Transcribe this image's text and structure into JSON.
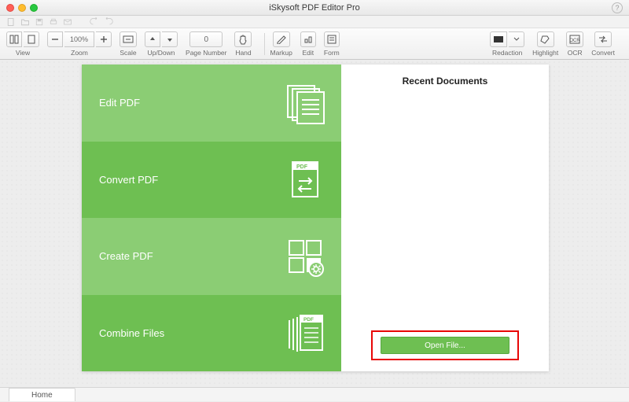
{
  "app": {
    "title": "iSkysoft PDF Editor Pro"
  },
  "toolbar": {
    "view": "View",
    "zoom_label": "Zoom",
    "zoom_value": "100%",
    "scale": "Scale",
    "updown": "Up/Down",
    "page_number_label": "Page Number",
    "page_number_value": "0",
    "hand": "Hand",
    "markup": "Markup",
    "edit": "Edit",
    "form": "Form",
    "redaction": "Redaction",
    "highlight": "Highlight",
    "ocr": "OCR",
    "convert": "Convert"
  },
  "welcome": {
    "tiles": [
      {
        "label": "Edit PDF"
      },
      {
        "label": "Convert PDF"
      },
      {
        "label": "Create PDF"
      },
      {
        "label": "Combine Files"
      }
    ],
    "recent_title": "Recent Documents",
    "open_file": "Open File...",
    "pdf_badge": "PDF"
  },
  "tabs": {
    "home": "Home"
  },
  "colors": {
    "tile_light": "#8bcd74",
    "tile_dark": "#6ebf52",
    "highlight_box": "#e80606"
  }
}
